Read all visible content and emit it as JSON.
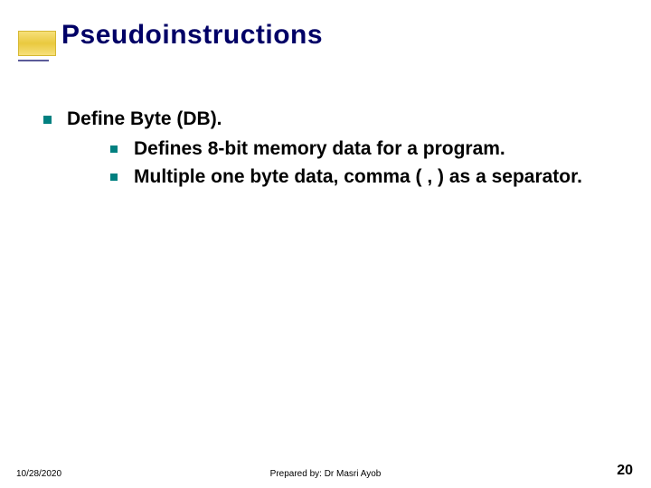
{
  "title": "Pseudoinstructions",
  "body": {
    "main": "Define Byte (DB).",
    "subs": [
      "Defines 8-bit memory data for a program.",
      "Multiple one byte data, comma ( , ) as a separator."
    ]
  },
  "footer": {
    "date": "10/28/2020",
    "author": "Prepared by: Dr Masri Ayob",
    "page": "20"
  }
}
